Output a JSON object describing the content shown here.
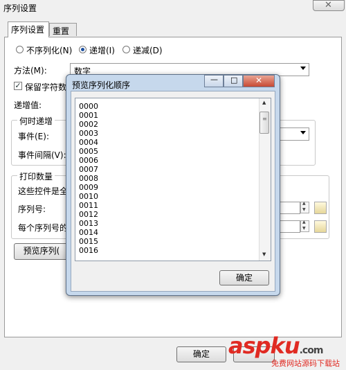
{
  "window": {
    "title": "序列设置",
    "close_symbol": "✕"
  },
  "tabs": [
    {
      "label": "序列设置"
    },
    {
      "label": "重置"
    }
  ],
  "radios": [
    {
      "label": "不序列化(N)",
      "checked": false
    },
    {
      "label": "递增(I)",
      "checked": true
    },
    {
      "label": "递减(D)",
      "checked": false
    }
  ],
  "method": {
    "label": "方法(M):",
    "value": "数字"
  },
  "keep_chars": {
    "label": "保留字符数",
    "checked": true,
    "check_symbol": "✓"
  },
  "increment": {
    "label": "递增值:"
  },
  "when_group": {
    "title": "何时递增",
    "event_label": "事件(E):",
    "interval_label": "事件间隔(V):"
  },
  "print_group": {
    "title": "打印数量",
    "desc": "这些控件是全",
    "serial_label": "序列号:",
    "each_label": "每个序列号的"
  },
  "preview_button": {
    "label": "预览序列("
  },
  "footer": {
    "ok_label": "确定"
  },
  "popup": {
    "title": "预览序列化顺序",
    "items": [
      "0000",
      "0001",
      "0002",
      "0003",
      "0004",
      "0005",
      "0006",
      "0007",
      "0008",
      "0009",
      "0010",
      "0011",
      "0012",
      "0013",
      "0014",
      "0015",
      "0016"
    ],
    "ok_label": "确定",
    "min_symbol": "—",
    "max_symbol": "□",
    "close_symbol": "✕"
  },
  "watermark": {
    "text": "aspku",
    "suffix": ".com",
    "sub": "免费网站源码下载站"
  }
}
